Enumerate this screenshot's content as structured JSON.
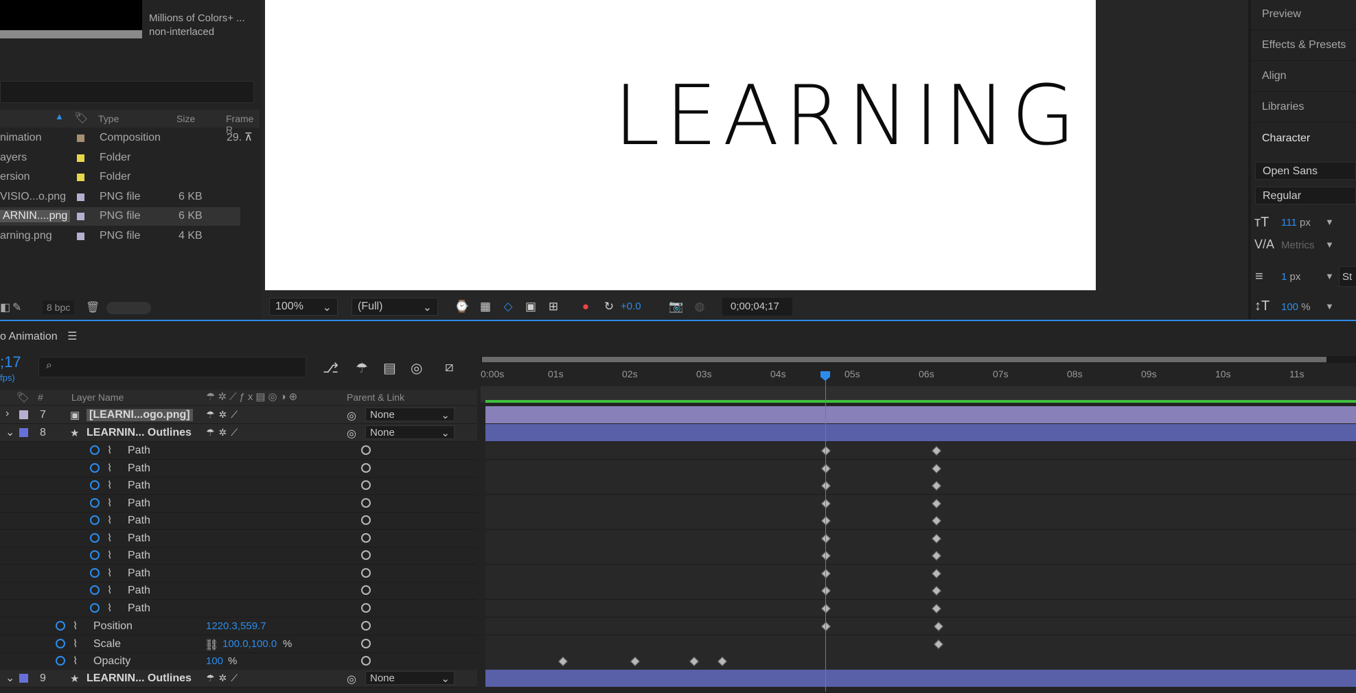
{
  "project": {
    "format_line1": "Millions of Colors+ ...",
    "format_line2": "non-interlaced",
    "columns": {
      "type": "Type",
      "size": "Size",
      "frame": "Frame R"
    },
    "items": [
      {
        "name": "nimation",
        "color": "#a48e72",
        "type": "Composition",
        "size": "",
        "frame": "29."
      },
      {
        "name": "ayers",
        "color": "#e6d84a",
        "type": "Folder",
        "size": "",
        "frame": ""
      },
      {
        "name": "ersion",
        "color": "#e6d84a",
        "type": "Folder",
        "size": "",
        "frame": ""
      },
      {
        "name": "VISIO...o.png",
        "color": "#b7afd0",
        "type": "PNG file",
        "size": "6 KB",
        "frame": ""
      },
      {
        "name": "ARNIN....png",
        "color": "#b7afd0",
        "type": "PNG file",
        "size": "6 KB",
        "frame": ""
      },
      {
        "name": "arning.png",
        "color": "#b7afd0",
        "type": "PNG file",
        "size": "4 KB",
        "frame": ""
      }
    ],
    "bpc": "8 bpc"
  },
  "viewer": {
    "canvas_text": "LEARNING",
    "zoom": "100%",
    "resolution": "(Full)",
    "exposure": "+0.0",
    "timecode": "0;00;04;17"
  },
  "right_panel": {
    "items": [
      "Preview",
      "Effects & Presets",
      "Align",
      "Libraries"
    ],
    "active": "Character",
    "font_family": "Open Sans",
    "font_style": "Regular",
    "font_size": "111",
    "font_size_unit": "px",
    "kerning": "Metrics",
    "stroke": "1",
    "stroke_unit": "px",
    "stroke_type": "St",
    "vscale": "100",
    "vscale_unit": "%"
  },
  "timeline": {
    "comp_tab": "o Animation",
    "current_time": ";17",
    "fps": "fps)",
    "ruler": [
      "0:00s",
      "01s",
      "02s",
      "03s",
      "04s",
      "05s",
      "06s",
      "07s",
      "08s",
      "09s",
      "10s",
      "11s"
    ],
    "headers": {
      "num": "#",
      "layer_name": "Layer Name",
      "parent": "Parent & Link"
    },
    "layers": [
      {
        "num": "7",
        "name": "[LEARNI...ogo.png]",
        "parent": "None",
        "color": "#b7afd0"
      },
      {
        "num": "8",
        "name": "LEARNIN... Outlines",
        "parent": "None",
        "color": "#6670d8"
      }
    ],
    "path_label": "Path",
    "path_count": 10,
    "props": [
      {
        "name": "Position",
        "value": "1220.3,559.7",
        "unit": ""
      },
      {
        "name": "Scale",
        "value": "100.0,100.0",
        "unit": "%"
      },
      {
        "name": "Opacity",
        "value": "100",
        "unit": "%"
      }
    ],
    "layer9": {
      "num": "9",
      "name": "LEARNIN... Outlines",
      "parent": "None",
      "color": "#6670d8"
    },
    "playhead_time": "04;17"
  }
}
